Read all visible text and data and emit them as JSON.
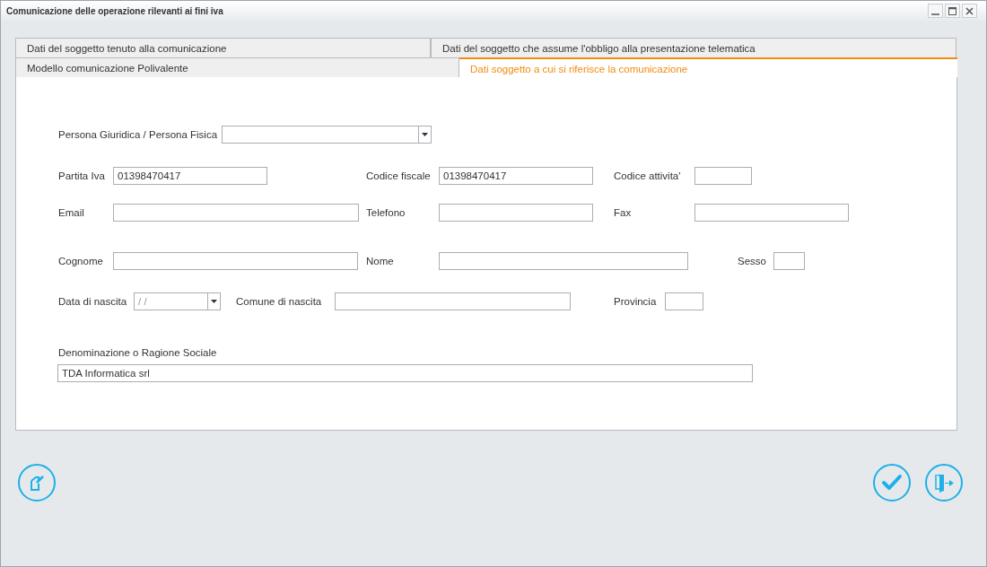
{
  "window": {
    "title": "Comunicazione delle operazione rilevanti ai fini iva"
  },
  "tab_rows": [
    [
      {
        "label": "Dati del soggetto tenuto alla comunicazione",
        "selected": false
      },
      {
        "label": "Dati del soggetto che assume l'obbligo alla presentazione telematica",
        "selected": false
      }
    ],
    [
      {
        "label": "Modello comunicazione Polivalente",
        "selected": false
      },
      {
        "label": "Dati soggetto a cui si riferisce la comunicazione",
        "selected": true
      }
    ]
  ],
  "form_rows": [
    [
      {
        "label": "Persona Giuridica / Persona Fisica",
        "kind": "select"
      }
    ],
    [
      {
        "label": "Partita Iva",
        "kind": "text",
        "value": "01398470417"
      },
      {
        "label": "Codice fiscale",
        "kind": "text",
        "value": "01398470417"
      },
      {
        "label": "Codice attivita'",
        "kind": "text"
      }
    ],
    [
      {
        "label": "Email",
        "kind": "text"
      },
      {
        "label": "Telefono",
        "kind": "text"
      },
      {
        "label": "Fax",
        "kind": "text"
      }
    ],
    [
      {
        "label": "Cognome",
        "kind": "text"
      },
      {
        "label": "Nome",
        "kind": "text"
      },
      {
        "label": "Sesso",
        "kind": "text"
      }
    ],
    [
      {
        "label": "Data di nascita",
        "kind": "date",
        "placeholder": "/ /"
      },
      {
        "label": "Comune di nascita",
        "kind": "text"
      },
      {
        "label": "Provincia",
        "kind": "text"
      }
    ]
  ],
  "company_field": {
    "label": "Denominazione o Ragione Sociale",
    "value": "TDA Informatica srl"
  }
}
